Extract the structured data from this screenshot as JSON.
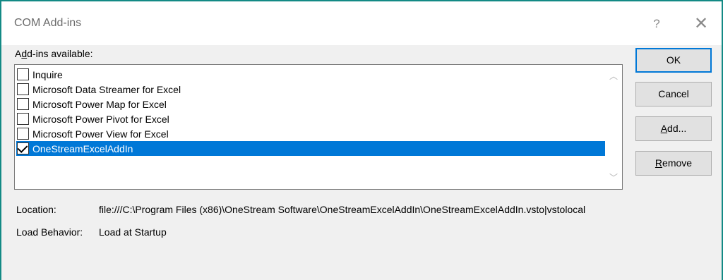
{
  "dialog": {
    "title": "COM Add-ins",
    "help_glyph": "?",
    "close_glyph": "✕"
  },
  "list": {
    "label_prefix": "A",
    "label_accel": "d",
    "label_rest": "d-ins available:",
    "items": [
      {
        "label": "Inquire",
        "checked": false,
        "selected": false
      },
      {
        "label": "Microsoft Data Streamer for Excel",
        "checked": false,
        "selected": false
      },
      {
        "label": "Microsoft Power Map for Excel",
        "checked": false,
        "selected": false
      },
      {
        "label": "Microsoft Power Pivot for Excel",
        "checked": false,
        "selected": false
      },
      {
        "label": "Microsoft Power View for Excel",
        "checked": false,
        "selected": false
      },
      {
        "label": "OneStreamExcelAddIn",
        "checked": true,
        "selected": true
      }
    ],
    "scroll_up_glyph": "︿",
    "scroll_down_glyph": "﹀"
  },
  "buttons": {
    "ok": "OK",
    "cancel": "Cancel",
    "add_accel": "A",
    "add_rest": "dd...",
    "remove_accel": "R",
    "remove_rest": "emove"
  },
  "info": {
    "location_label": "Location:",
    "location_value": "file:///C:\\Program Files (x86)\\OneStream Software\\OneStreamExcelAddIn\\OneStreamExcelAddIn.vsto|vstolocal",
    "load_behavior_label": "Load Behavior:",
    "load_behavior_value": "Load at Startup"
  },
  "colors": {
    "selection": "#0078d7",
    "window_border": "#138a85"
  }
}
